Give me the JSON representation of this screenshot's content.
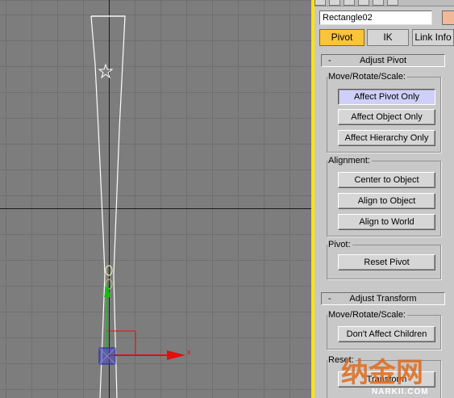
{
  "object": {
    "name": "Rectangle02",
    "color": "#f2b898"
  },
  "tabs": [
    {
      "label": "Pivot",
      "active": true
    },
    {
      "label": "IK",
      "active": false
    },
    {
      "label": "Link Info",
      "active": false
    }
  ],
  "adjust_pivot": {
    "title": "Adjust Pivot",
    "collapse_sign": "-",
    "move_group": {
      "label": "Move/Rotate/Scale:",
      "buttons": [
        "Affect Pivot Only",
        "Affect Object Only",
        "Affect Hierarchy Only"
      ],
      "active_button": "Affect Pivot Only"
    },
    "alignment_group": {
      "label": "Alignment:",
      "buttons": [
        "Center to Object",
        "Align to Object",
        "Align to World"
      ]
    },
    "pivot_group": {
      "label": "Pivot:",
      "buttons": [
        "Reset Pivot"
      ]
    }
  },
  "adjust_transform": {
    "title": "Adjust Transform",
    "collapse_sign": "-",
    "move_group": {
      "label": "Move/Rotate/Scale:",
      "buttons": [
        "Don't Affect Children"
      ]
    },
    "reset_group": {
      "label": "Reset:",
      "buttons": [
        "Transform"
      ]
    }
  },
  "viewport": {
    "gizmo_axis_label": "x"
  },
  "watermark": {
    "text": "纳金网",
    "url": "NARKII.COM"
  },
  "colors": {
    "accent_tab": "#f9c43b",
    "pressed_button": "#cfcff9",
    "viewport_bg": "#7d7d7d",
    "divider": "#ffe400",
    "gizmo_x": "#e01010",
    "gizmo_y": "#10c010",
    "watermark": "#e06a1a"
  }
}
